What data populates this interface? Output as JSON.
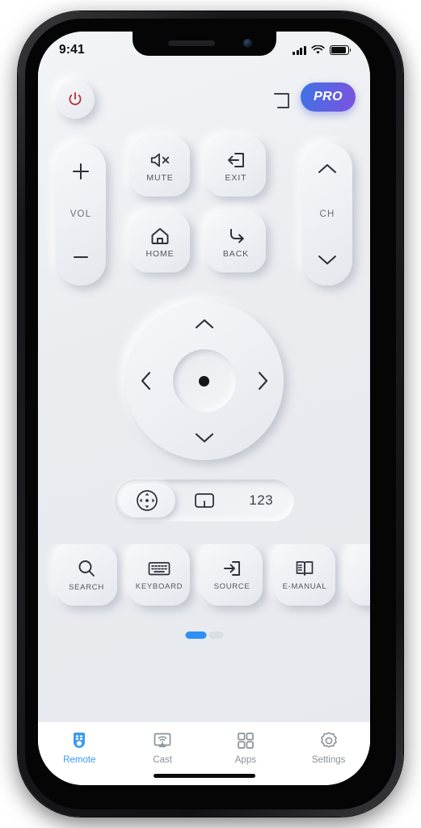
{
  "status_bar": {
    "time": "9:41",
    "signal_icon": "signal-bars-icon",
    "wifi_icon": "wifi-icon",
    "battery_icon": "battery-icon"
  },
  "header": {
    "power_icon": "power-icon",
    "power_color": "#b5323c",
    "fullscreen_icon": "fullscreen-corner-icon",
    "pro_label": "PRO",
    "pro_gradient_from": "#3f72e6",
    "pro_gradient_to": "#7c53dd"
  },
  "controls": {
    "volume": {
      "label": "VOL",
      "up_icon": "plus-icon",
      "down_icon": "minus-icon"
    },
    "channel": {
      "label": "CH",
      "up_icon": "chevron-up-icon",
      "down_icon": "chevron-down-icon"
    },
    "buttons": [
      {
        "label": "MUTE",
        "icon": "speaker-mute-icon"
      },
      {
        "label": "EXIT",
        "icon": "exit-arrow-icon"
      },
      {
        "label": "HOME",
        "icon": "home-icon"
      },
      {
        "label": "BACK",
        "icon": "back-arrow-icon"
      }
    ]
  },
  "dpad": {
    "up_icon": "chevron-up-icon",
    "down_icon": "chevron-down-icon",
    "left_icon": "chevron-left-icon",
    "right_icon": "chevron-right-icon",
    "center_icon": "ok-dot-icon"
  },
  "mode_bar": {
    "segments": [
      {
        "name": "dpad",
        "icon": "dpad-mode-icon",
        "label": "",
        "active": true
      },
      {
        "name": "touchpad",
        "icon": "touchpad-icon",
        "label": "",
        "active": false
      },
      {
        "name": "numpad",
        "icon": "",
        "label": "123",
        "active": false
      }
    ]
  },
  "shortcuts": [
    {
      "label": "SEARCH",
      "icon": "search-icon"
    },
    {
      "label": "KEYBOARD",
      "icon": "keyboard-icon"
    },
    {
      "label": "SOURCE",
      "icon": "source-input-icon"
    },
    {
      "label": "E-MANUAL",
      "icon": "book-icon"
    },
    {
      "label": "",
      "icon": "partial-card-icon"
    }
  ],
  "page_indicator": {
    "active_index": 0,
    "total": 2,
    "active_color": "#2e90f5",
    "inactive_color": "#dadde2"
  },
  "tab_bar": {
    "active_color": "#3b9af0",
    "inactive_color": "#8b9099",
    "tabs": [
      {
        "label": "Remote",
        "icon": "remote-icon",
        "active": true
      },
      {
        "label": "Cast",
        "icon": "cast-icon",
        "active": false
      },
      {
        "label": "Apps",
        "icon": "apps-grid-icon",
        "active": false
      },
      {
        "label": "Settings",
        "icon": "gear-icon",
        "active": false
      }
    ]
  }
}
